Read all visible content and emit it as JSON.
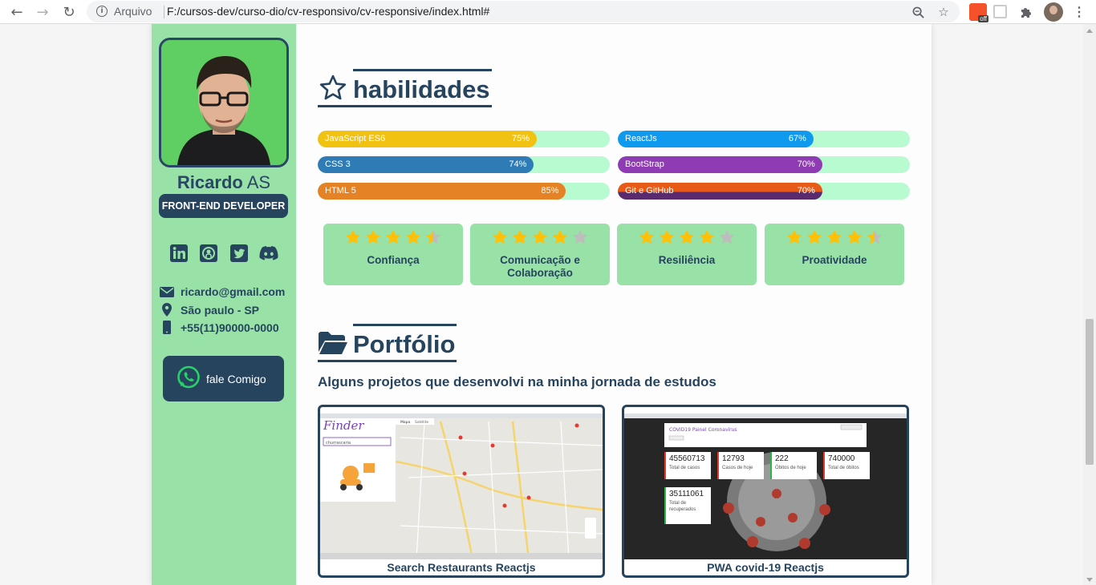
{
  "browser": {
    "site_label": "Arquivo",
    "url": "F:/cursos-dev/curso-dio/cv-responsivo/cv-responsive/index.html#",
    "extension_badge": "off"
  },
  "profile": {
    "first_name": "Ricardo",
    "last_name": "AS",
    "role": "FRONT-END DEVELOPER",
    "socials": [
      "linkedin-icon",
      "github-icon",
      "twitter-icon",
      "discord-icon"
    ],
    "email": "ricardo@gmail.com",
    "location": "São paulo - SP",
    "phone": "+55(11)90000-0000",
    "cta_label": "fale Comigo"
  },
  "skills_section": {
    "title": "habilidades",
    "bars": [
      {
        "name": "JavaScript ES6",
        "percent_label": "75%",
        "value": 0.75,
        "color": "#f2c212"
      },
      {
        "name": "ReactJs",
        "percent_label": "67%",
        "value": 0.67,
        "color": "#0f9af0"
      },
      {
        "name": "CSS 3",
        "percent_label": "74%",
        "value": 0.74,
        "color": "#2f7bb5"
      },
      {
        "name": "BootStrap",
        "percent_label": "70%",
        "value": 0.7,
        "color": "#8f3cb4"
      },
      {
        "name": "HTML 5",
        "percent_label": "85%",
        "value": 0.85,
        "color": "#e58226"
      },
      {
        "name": "Git e GitHub",
        "percent_label": "70%",
        "value": 0.7,
        "color": "#e75a18"
      }
    ],
    "soft_skills": [
      {
        "label": "Confiança",
        "rating": 4.5
      },
      {
        "label": "Comunicação e Colaboração",
        "rating": 4
      },
      {
        "label": "Resiliência",
        "rating": 4
      },
      {
        "label": "Proatividade",
        "rating": 4.5
      }
    ]
  },
  "portfolio_section": {
    "title": "Portfólio",
    "subtitle": "Alguns projetos que desenvolvi na minha jornada de estudos",
    "projects": [
      {
        "title": "Search Restaurants Reactjs",
        "thumb_logo": "Finder",
        "thumb_search": "churrascaria",
        "thumb_tab_a": "Mapa",
        "thumb_tab_b": "Satélite"
      },
      {
        "title": "PWA covid-19 Reactjs",
        "thumb_header": "COVID19 Painel Coronavírus",
        "stats": [
          {
            "value": "45560713",
            "label": "Total de casos"
          },
          {
            "value": "12793",
            "label": "Casos de hoje"
          },
          {
            "value": "222",
            "label": "Óbitos de hoje"
          },
          {
            "value": "740000",
            "label": "Total de óbitos"
          },
          {
            "value": "35111061",
            "label": "Total de recuperados"
          }
        ]
      }
    ]
  },
  "colors": {
    "primary": "#27445f",
    "sidebar": "#98e2a7",
    "bar_track": "#b8fbd0",
    "star_on": "#ffc107",
    "star_off": "#bdbdbd"
  }
}
